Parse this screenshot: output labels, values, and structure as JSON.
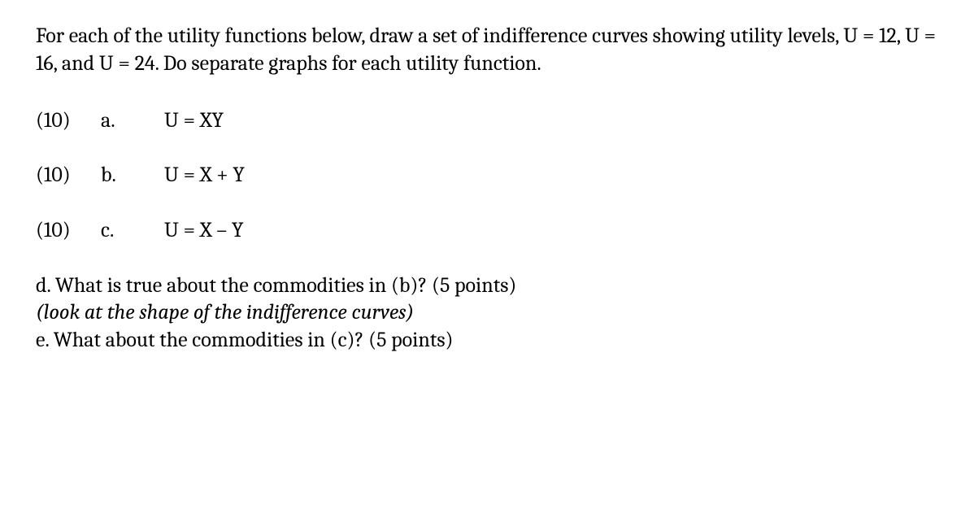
{
  "intro": "For each of the utility functions below, draw a set of indifference curves showing utility levels, U = 12, U = 16, and U = 24. Do separate graphs for each utility function.",
  "items": [
    {
      "points": "(10)",
      "letter": "a.",
      "formula": "U = XY"
    },
    {
      "points": "(10)",
      "letter": "b.",
      "formula": "U = X + Y"
    },
    {
      "points": "(10)",
      "letter": "c.",
      "formula": "U = X – Y"
    }
  ],
  "followup": {
    "d": "d. What is true about the commodities in (b)? (5 points)",
    "d_hint": "(look at the shape of the indifference curves)",
    "e": "e. What about the commodities in (c)?  (5 points)"
  }
}
